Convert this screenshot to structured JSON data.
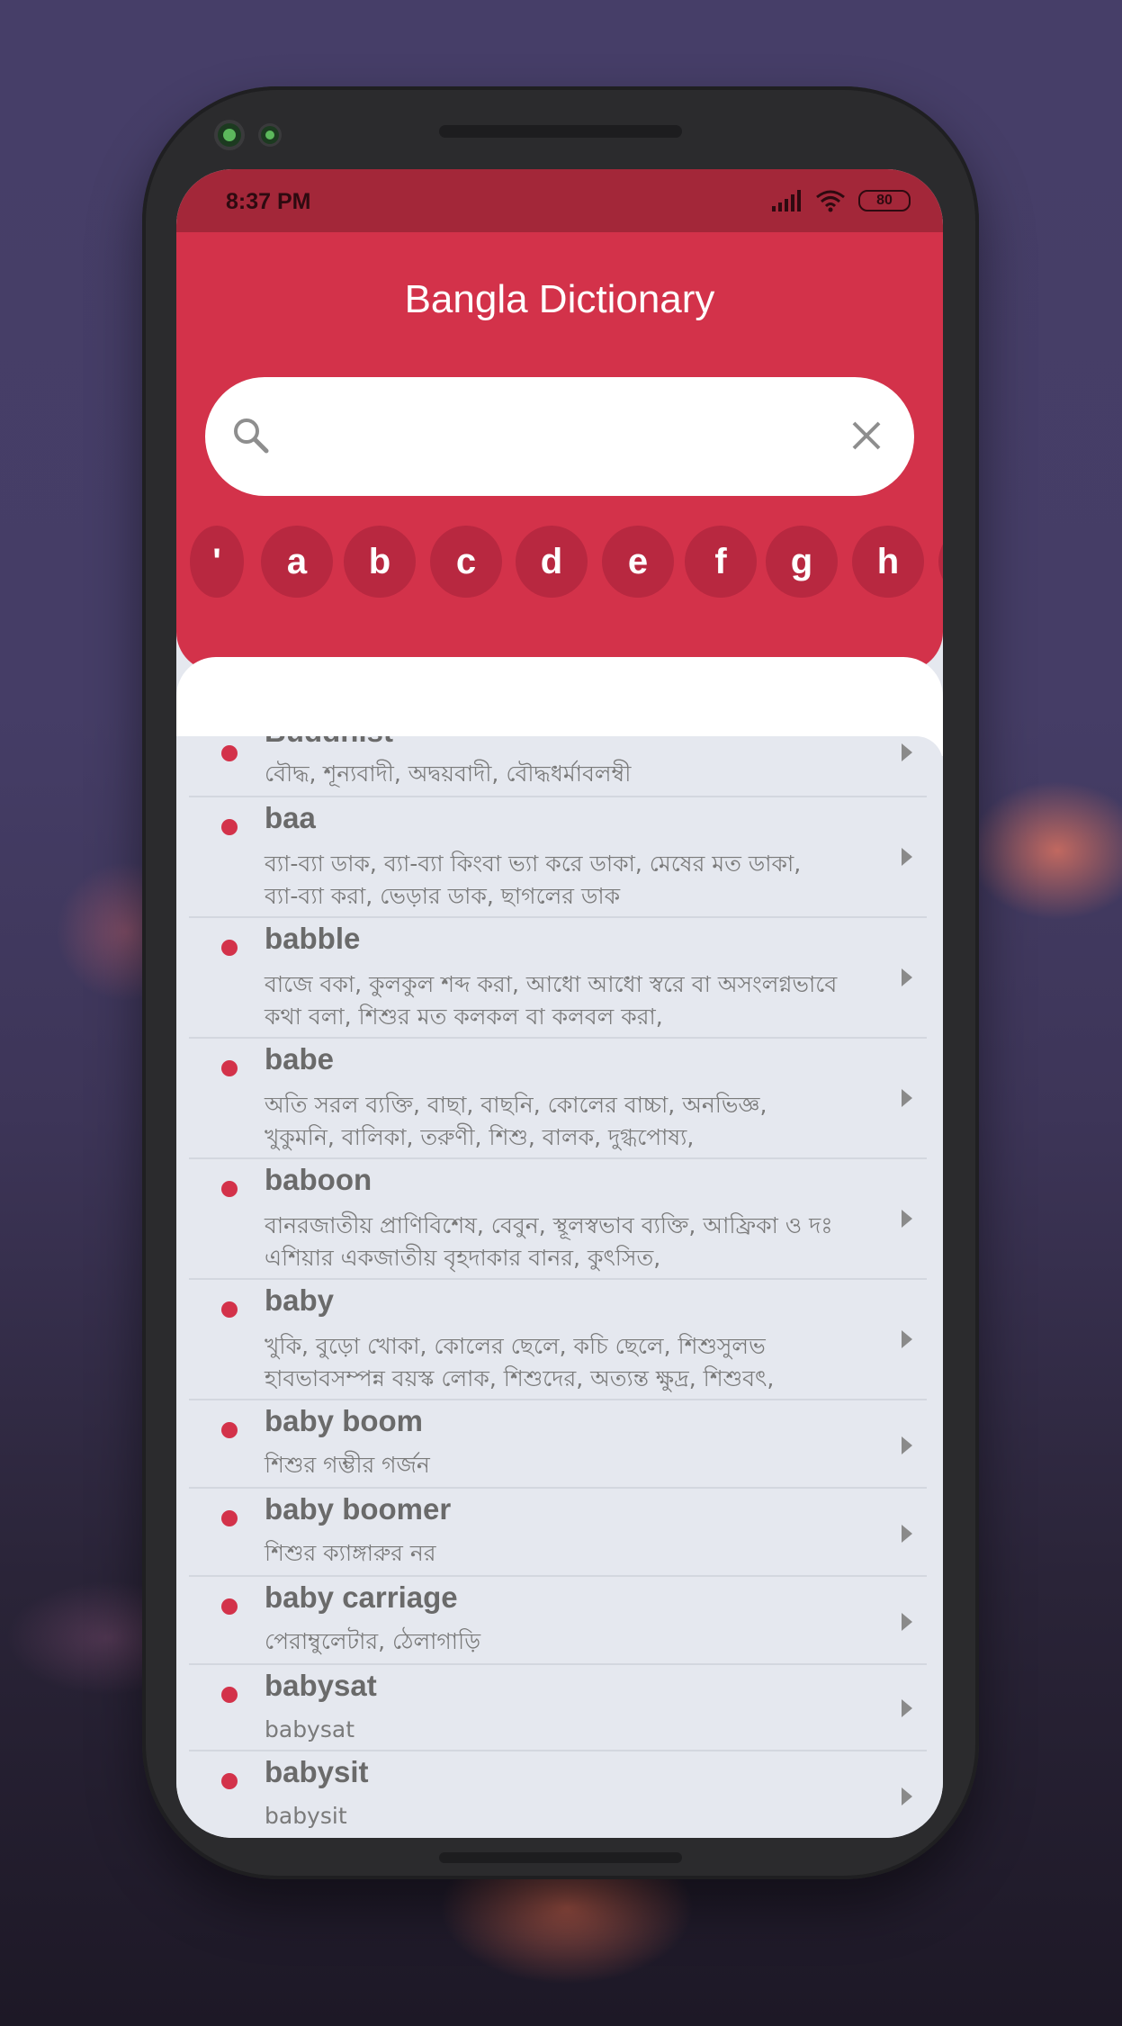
{
  "status_bar": {
    "time": "8:37 PM",
    "battery": "80"
  },
  "app": {
    "title": "Bangla Dictionary"
  },
  "search": {
    "value": "",
    "placeholder": ""
  },
  "letters": [
    "'",
    "a",
    "b",
    "c",
    "d",
    "e",
    "f",
    "g",
    "h"
  ],
  "entries": [
    {
      "word": "Buddhist",
      "meaning": "বৌদ্ধ, শূন্যবাদী, অদ্বয়বাদী, বৌদ্ধধর্মাবলম্বী"
    },
    {
      "word": "baa",
      "meaning": "ব্যা-ব্যা ডাক, ব্যা-ব্যা কিংবা ভ্যা করে ডাকা, মেষের মত ডাকা, ব্যা-ব্যা করা, ভেড়ার ডাক, ছাগলের ডাক"
    },
    {
      "word": "babble",
      "meaning": "বাজে বকা, কুলকুল শব্দ করা, আধো আধো স্বরে বা অসংলগ্নভাবে কথা বলা, শিশুর মত কলকল বা কলবল করা,"
    },
    {
      "word": "babe",
      "meaning": "অতি সরল ব্যক্তি, বাছা, বাছনি, কোলের বাচ্চা, অনভিজ্ঞ, খুকুমনি, বালিকা, তরুণী, শিশু, বালক, দুগ্ধপোষ্য,"
    },
    {
      "word": "baboon",
      "meaning": "বানরজাতীয় প্রাণিবিশেষ, বেবুন, স্থূলস্বভাব ব্যক্তি, আফ্রিকা ও দঃ এশিয়ার একজাতীয় বৃহদাকার বানর, কুৎসিত,"
    },
    {
      "word": "baby",
      "meaning": "খুকি, বুড়ো খোকা, কোলের ছেলে, কচি ছেলে, শিশুসুলভ হাবভাবসম্পন্ন বয়স্ক লোক, শিশুদের, অত্যন্ত ক্ষুদ্র, শিশুবৎ,"
    },
    {
      "word": "baby boom",
      "meaning": "শিশুর গম্ভীর গর্জন"
    },
    {
      "word": "baby boomer",
      "meaning": "শিশুর ক্যাঙ্গারুর নর"
    },
    {
      "word": "baby carriage",
      "meaning": "পেরাম্বুলেটার, ঠেলাগাড়ি"
    },
    {
      "word": "babysat",
      "meaning": "babysat"
    },
    {
      "word": "babysit",
      "meaning": "babysit"
    }
  ],
  "colors": {
    "primary": "#d3324a",
    "status_bar": "#a32739",
    "letter_chip": "#b82840",
    "list_bg": "#e5e8ef"
  },
  "icons": {
    "search": "search-icon",
    "clear": "close-icon",
    "row_arrow": "caret-right-icon"
  }
}
